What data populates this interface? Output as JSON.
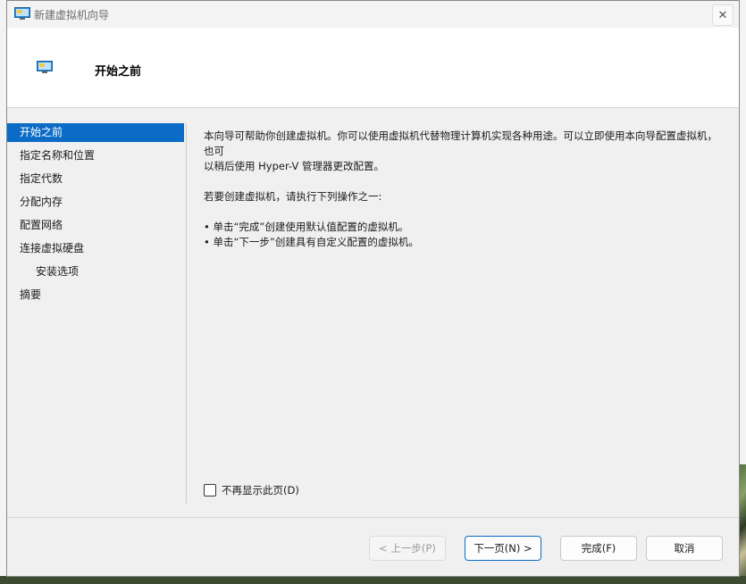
{
  "window": {
    "title": "新建虚拟机向导",
    "close_symbol": "✕"
  },
  "header": {
    "title": "开始之前"
  },
  "sidebar": {
    "items": [
      {
        "label": "开始之前",
        "active": true,
        "sub": false
      },
      {
        "label": "指定名称和位置",
        "active": false,
        "sub": false
      },
      {
        "label": "指定代数",
        "active": false,
        "sub": false
      },
      {
        "label": "分配内存",
        "active": false,
        "sub": false
      },
      {
        "label": "配置网络",
        "active": false,
        "sub": false
      },
      {
        "label": "连接虚拟硬盘",
        "active": false,
        "sub": false
      },
      {
        "label": "安装选项",
        "active": false,
        "sub": true
      },
      {
        "label": "摘要",
        "active": false,
        "sub": false
      }
    ]
  },
  "content": {
    "intro_line1": "本向导可帮助你创建虚拟机。你可以使用虚拟机代替物理计算机实现各种用途。可以立即使用本向导配置虚拟机，也可",
    "intro_line2": "以稍后使用 Hyper-V 管理器更改配置。",
    "instruction": "若要创建虚拟机，请执行下列操作之一:",
    "bullet1": "• 单击“完成”创建使用默认值配置的虚拟机。",
    "bullet2": "• 单击“下一步”创建具有自定义配置的虚拟机。"
  },
  "checkbox": {
    "label": "不再显示此页(D)",
    "checked": false
  },
  "buttons": {
    "prev": "< 上一步(P)",
    "next": "下一页(N) >",
    "finish": "完成(F)",
    "cancel": "取消"
  },
  "colors": {
    "accent": "#0a6cc6"
  }
}
